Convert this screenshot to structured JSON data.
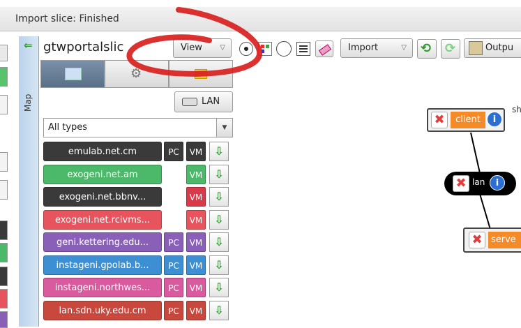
{
  "status": {
    "text": "Import slice: Finished"
  },
  "map_tab": {
    "label": "Map"
  },
  "slice": {
    "name": "gtwportalslic"
  },
  "toolbar": {
    "view_label": "View",
    "import_label": "Import",
    "output_label": "Outpu"
  },
  "panel": {
    "lan_label": "LAN",
    "type_filter": "All types",
    "aggregates": [
      {
        "name": "emulab.net.cm",
        "color": "#3a3a3a",
        "pc": "PC",
        "vm": "VM",
        "pc_color": "#3a3a3a",
        "vm_color": "#3a3a3a"
      },
      {
        "name": "exogeni.net.am",
        "color": "#4cb86a",
        "pc": "",
        "vm": "VM",
        "pc_color": "",
        "vm_color": "#4cb86a"
      },
      {
        "name": "exogeni.net.bbnv...",
        "color": "#3a3a3a",
        "pc": "",
        "vm": "VM",
        "pc_color": "",
        "vm_color": "#d83a4a"
      },
      {
        "name": "exogeni.net.rcivms...",
        "color": "#e8545e",
        "pc": "",
        "vm": "VM",
        "pc_color": "",
        "vm_color": "#e8545e"
      },
      {
        "name": "geni.kettering.edu...",
        "color": "#8a5fb8",
        "pc": "PC",
        "vm": "VM",
        "pc_color": "#8a5fb8",
        "vm_color": "#8a5fb8"
      },
      {
        "name": "instageni.gpolab.b...",
        "color": "#3d8fd4",
        "pc": "PC",
        "vm": "VM",
        "pc_color": "#3d8fd4",
        "vm_color": "#3d8fd4"
      },
      {
        "name": "instageni.northwes...",
        "color": "#d95a9e",
        "pc": "PC",
        "vm": "VM",
        "pc_color": "#d95a9e",
        "vm_color": "#d95a9e"
      },
      {
        "name": "lan.sdn.uky.edu.cm",
        "color": "#c8483e",
        "pc": "PC",
        "vm": "VM",
        "pc_color": "#c8483e",
        "vm_color": "#c8483e"
      }
    ]
  },
  "canvas": {
    "nodes": [
      {
        "label": "client"
      },
      {
        "label": "lan"
      },
      {
        "label": "serve"
      }
    ],
    "cut_text": "sh"
  }
}
